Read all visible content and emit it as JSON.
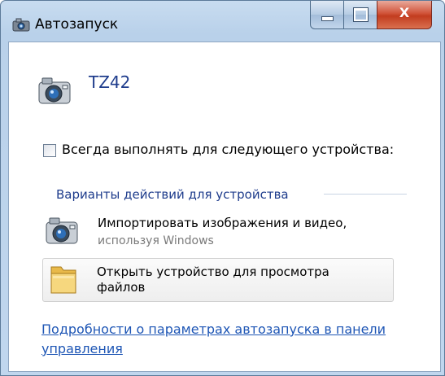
{
  "window": {
    "title": "Автозапуск",
    "controls": {
      "minimize": "minimize",
      "maximize": "maximize",
      "close_label": "X"
    }
  },
  "device": {
    "name": "TZ42",
    "icon": "camera-icon"
  },
  "always_checkbox": {
    "label": "Всегда выполнять для следующего устройства:",
    "checked": false
  },
  "section": {
    "title": "Варианты действий для устройства"
  },
  "options": [
    {
      "label": "Импортировать изображения и видео,",
      "sublabel": "используя Windows",
      "icon": "camera-icon"
    },
    {
      "label": "Открыть устройство для просмотра файлов",
      "icon": "folder-icon"
    }
  ],
  "link": {
    "text": "Подробности о параметрах автозапуска в панели управления"
  },
  "colors": {
    "link": "#1e56b5",
    "heading": "#1e3c8c",
    "titlebar": "#b9d1ea",
    "close_button": "#c23c1f"
  }
}
